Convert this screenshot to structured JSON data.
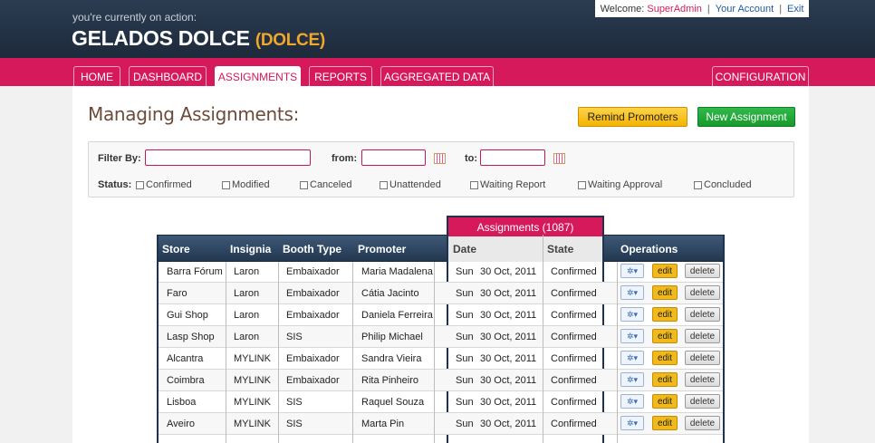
{
  "header": {
    "context_label": "you're currently on action:",
    "project_name": "GELADOS DOLCE",
    "project_code": "(DOLCE)"
  },
  "user_bar": {
    "welcome_prefix": "Welcome:",
    "username": "SuperAdmin",
    "your_account": "Your Account",
    "exit": "Exit",
    "separator": "|"
  },
  "nav": {
    "tabs": [
      {
        "label": "HOME"
      },
      {
        "label": "DASHBOARD"
      },
      {
        "label": "ASSIGNMENTS",
        "active": true
      },
      {
        "label": "REPORTS"
      },
      {
        "label": "AGGREGATED DATA"
      },
      {
        "label": "CONFIGURATION"
      }
    ]
  },
  "page": {
    "title": "Managing Assignments:",
    "remind_button": "Remind Promoters",
    "new_button": "New Assignment"
  },
  "filter": {
    "filter_by_label": "Filter By:",
    "filter_by_value": "",
    "from_label": "from:",
    "from_value": "",
    "to_label": "to:",
    "to_value": "",
    "status_label": "Status:",
    "statuses": [
      "Confirmed",
      "Modified",
      "Canceled",
      "Unattended",
      "Waiting Report",
      "Waiting Approval",
      "Concluded"
    ]
  },
  "table": {
    "caption": "Assignments (1087)",
    "columns": [
      "Store",
      "Insignia",
      "Booth Type",
      "Promoter",
      "Date",
      "State",
      "Operations"
    ],
    "edit_label": "edit",
    "delete_label": "delete",
    "gear_label": "✲▾",
    "rows": [
      {
        "store": "Barra Fórum",
        "insignia": "Laron",
        "booth": "Embaixador",
        "promoter": "Maria Madalena",
        "day": "Sun",
        "date": "30 Oct, 2011",
        "state": "Confirmed"
      },
      {
        "store": "Faro",
        "insignia": "Laron",
        "booth": "Embaixador",
        "promoter": "Cátia Jacinto",
        "day": "Sun",
        "date": "30 Oct, 2011",
        "state": "Confirmed"
      },
      {
        "store": "Gui Shop",
        "insignia": "Laron",
        "booth": "Embaixador",
        "promoter": "Daniela Ferreira",
        "day": "Sun",
        "date": "30 Oct, 2011",
        "state": "Confirmed"
      },
      {
        "store": "Lasp Shop",
        "insignia": "Laron",
        "booth": "SIS",
        "promoter": "Philip Michael",
        "day": "Sun",
        "date": "30 Oct, 2011",
        "state": "Confirmed"
      },
      {
        "store": "Alcantra",
        "insignia": "MYLINK",
        "booth": "Embaixador",
        "promoter": "Sandra Vieira",
        "day": "Sun",
        "date": "30 Oct, 2011",
        "state": "Confirmed"
      },
      {
        "store": "Coimbra",
        "insignia": "MYLINK",
        "booth": "Embaixador",
        "promoter": "Rita Pinheiro",
        "day": "Sun",
        "date": "30 Oct, 2011",
        "state": "Confirmed"
      },
      {
        "store": "Lisboa",
        "insignia": "MYLINK",
        "booth": "SIS",
        "promoter": "Raquel Souza",
        "day": "Sun",
        "date": "30 Oct, 2011",
        "state": "Confirmed"
      },
      {
        "store": "Aveiro",
        "insignia": "MYLINK",
        "booth": "SIS",
        "promoter": "Marta Pin",
        "day": "Sun",
        "date": "30 Oct, 2011",
        "state": "Confirmed"
      }
    ]
  },
  "colors": {
    "brand": "#d5195a",
    "header_dark": "#1d2a3b",
    "accent_orange": "#f0a82a",
    "new_green": "#169a2c"
  }
}
